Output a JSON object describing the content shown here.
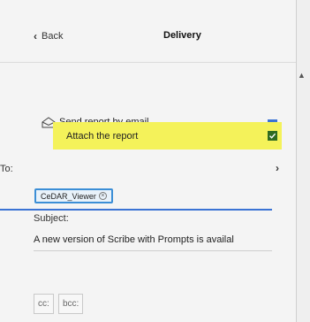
{
  "header": {
    "back_label": "Back",
    "title": "Delivery"
  },
  "email": {
    "label": "Send report by email",
    "checked": true,
    "check_color": "#3b73d4"
  },
  "attach": {
    "label": "Attach the report",
    "checked": true,
    "highlight_color": "#f4f25a",
    "check_color": "#2f6b21"
  },
  "to": {
    "label": "To:",
    "recipients": [
      "CeDAR_Viewer"
    ]
  },
  "subject": {
    "label": "Subject:",
    "value": "A new version of Scribe with Prompts is availal"
  },
  "buttons": {
    "cc_label": "cc:",
    "bcc_label": "bcc:"
  },
  "icons": {
    "back": "chevron-left-icon",
    "email": "envelope-icon",
    "to": "chevron-right-icon",
    "remove": "close-circle-icon",
    "scroll": "scroll-up-icon"
  }
}
